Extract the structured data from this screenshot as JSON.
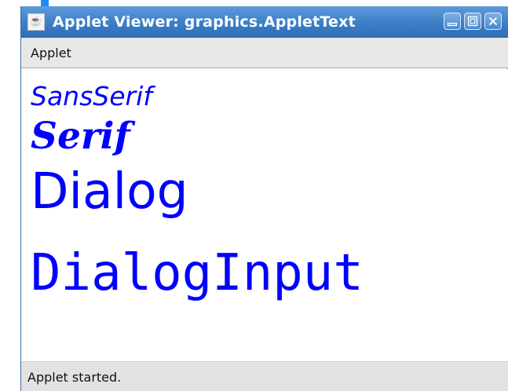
{
  "window": {
    "title": "Applet Viewer: graphics.AppletText",
    "app_icon": "java-cup-icon",
    "controls": [
      "minimize-icon",
      "maximize-icon",
      "close-icon"
    ]
  },
  "menubar": {
    "items": [
      {
        "label": "Applet"
      }
    ]
  },
  "content": {
    "text_color": "#0000ff",
    "samples": [
      {
        "text": "SansSerif"
      },
      {
        "text": "Serif"
      },
      {
        "text": "Dialog"
      },
      {
        "text": "DialogInput"
      }
    ]
  },
  "status": {
    "text": "Applet started."
  },
  "colors": {
    "titlebar": "#3b7fc7",
    "menubar": "#e8e8e8",
    "statusbar": "#e2e2e2"
  }
}
